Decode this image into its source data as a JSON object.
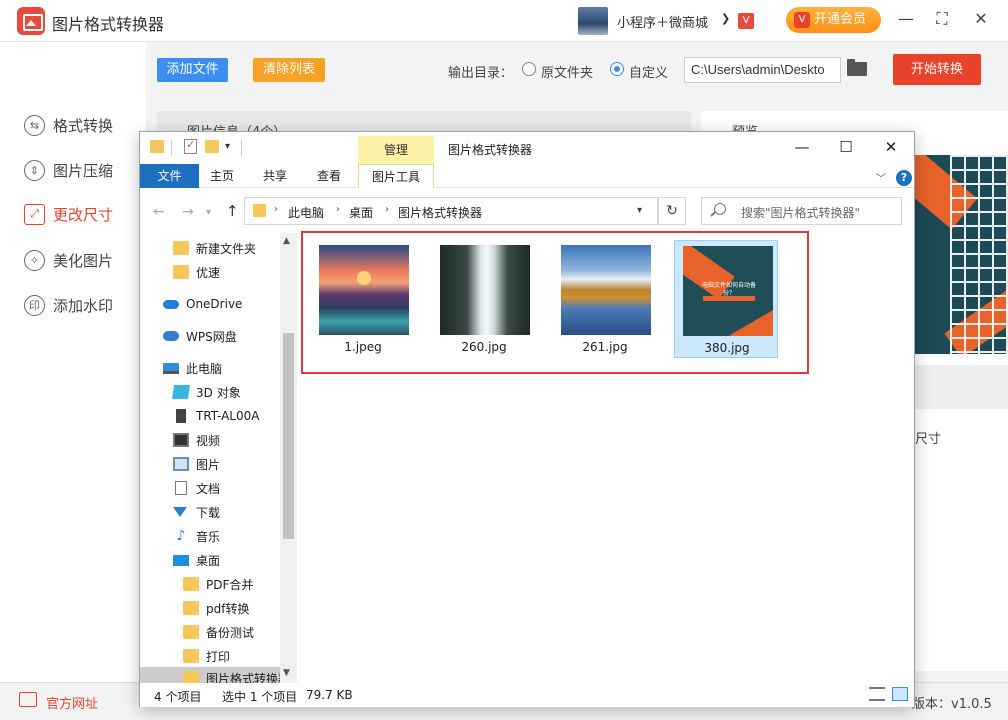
{
  "app": {
    "title": "图片格式转换器",
    "promo_text": "小程序＋微商城",
    "promo_chevron": "❯",
    "vip_icon": "V",
    "member_button": "开通会员",
    "win_controls": {
      "minimize": "—",
      "maximize": "⛶",
      "close": "✕"
    }
  },
  "sidebar": {
    "items": [
      {
        "label": "格式转换",
        "icon": "⇆"
      },
      {
        "label": "图片压缩",
        "icon": "⇕"
      },
      {
        "label": "更改尺寸",
        "icon": "⤢"
      },
      {
        "label": "美化图片",
        "icon": "✧"
      },
      {
        "label": "添加水印",
        "icon": "印"
      }
    ]
  },
  "toolbar": {
    "add_file": "添加文件",
    "clear_list": "清除列表",
    "output_label": "输出目录：",
    "radio_original": "原文件夹",
    "radio_custom": "自定义",
    "output_path": "C:\\Users\\admin\\Deskto",
    "start_button": "开始转换"
  },
  "panels": {
    "left_title": "图片信息（4个）",
    "right_title": "预览",
    "size_text": "尺寸"
  },
  "footer": {
    "site_link": "官方网址",
    "version": "版本：v1.0.5"
  },
  "explorer": {
    "context_tab": "管理",
    "title": "图片格式转换器",
    "controls": {
      "minimize": "—",
      "maximize": "☐",
      "close": "✕"
    },
    "ribbon_tabs": [
      "文件",
      "主页",
      "共享",
      "查看",
      "图片工具"
    ],
    "help": "?",
    "breadcrumb": [
      "此电脑",
      "桌面",
      "图片格式转换器"
    ],
    "search_placeholder": "搜索\"图片格式转换器\"",
    "nav": [
      {
        "label": "新建文件夹",
        "icon": "folder-icon"
      },
      {
        "label": "优速",
        "icon": "folder-icon"
      },
      {
        "label": "OneDrive",
        "icon": "cloud-icon"
      },
      {
        "label": "WPS网盘",
        "icon": "wps-icon"
      },
      {
        "label": "此电脑",
        "icon": "pc-icon"
      },
      {
        "label": "3D 对象",
        "icon": "cube-icon"
      },
      {
        "label": "TRT-AL00A",
        "icon": "phone-icon"
      },
      {
        "label": "视频",
        "icon": "video-icon"
      },
      {
        "label": "图片",
        "icon": "picture-icon"
      },
      {
        "label": "文档",
        "icon": "document-icon"
      },
      {
        "label": "下载",
        "icon": "download-icon"
      },
      {
        "label": "音乐",
        "icon": "music-icon"
      },
      {
        "label": "桌面",
        "icon": "desktop-icon"
      },
      {
        "label": "PDF合并",
        "icon": "folder-icon"
      },
      {
        "label": "pdf转换",
        "icon": "folder-icon"
      },
      {
        "label": "备份测试",
        "icon": "folder-icon"
      },
      {
        "label": "打印",
        "icon": "folder-icon"
      },
      {
        "label": "图片格式转换器",
        "icon": "folder-icon"
      }
    ],
    "files": [
      {
        "name": "1.jpeg",
        "selected": false
      },
      {
        "name": "260.jpg",
        "selected": false
      },
      {
        "name": "261.jpg",
        "selected": false
      },
      {
        "name": "380.jpg",
        "selected": true
      }
    ],
    "thumb_380_text": "电脑文件如何自动备份？",
    "status": {
      "count": "4 个项目",
      "selected": "选中 1 个项目",
      "size": "79.7 KB"
    }
  },
  "colors": {
    "accent_red": "#e8422a",
    "accent_blue": "#3b8ef0",
    "accent_orange": "#f7a125",
    "selection_blue": "#cce8ff",
    "highlight_frame": "#e23a3a"
  }
}
